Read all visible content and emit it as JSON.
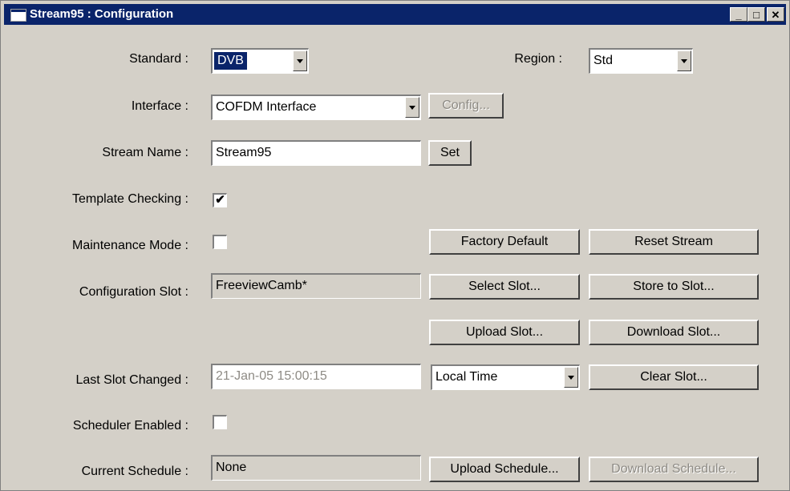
{
  "window": {
    "title": "Stream95 : Configuration",
    "minimize": "_",
    "maximize": "□",
    "close": "✕"
  },
  "standard": {
    "label": "Standard :",
    "value": "DVB"
  },
  "region": {
    "label": "Region :",
    "value": "Std"
  },
  "interface": {
    "label": "Interface :",
    "value": "COFDM Interface",
    "config_button": "Config..."
  },
  "stream_name": {
    "label": "Stream Name :",
    "value": "Stream95",
    "set_button": "Set"
  },
  "template_checking": {
    "label": "Template Checking :",
    "checked": true,
    "mark": "✔"
  },
  "maintenance_mode": {
    "label": "Maintenance Mode :",
    "checked": false,
    "mark": ""
  },
  "factory_default_button": "Factory Default",
  "reset_stream_button": "Reset Stream",
  "configuration_slot": {
    "label": "Configuration Slot :",
    "value": "FreeviewCamb*"
  },
  "select_slot_button": "Select Slot...",
  "store_to_slot_button": "Store to Slot...",
  "upload_slot_button": "Upload Slot...",
  "download_slot_button": "Download Slot...",
  "last_slot_changed": {
    "label": "Last Slot Changed :",
    "value": "21-Jan-05 15:00:15",
    "time_mode": "Local Time"
  },
  "clear_slot_button": "Clear Slot...",
  "scheduler_enabled": {
    "label": "Scheduler Enabled :",
    "checked": false,
    "mark": ""
  },
  "current_schedule": {
    "label": "Current Schedule :",
    "value": "None"
  },
  "upload_schedule_button": "Upload Schedule...",
  "download_schedule_button": "Download Schedule..."
}
